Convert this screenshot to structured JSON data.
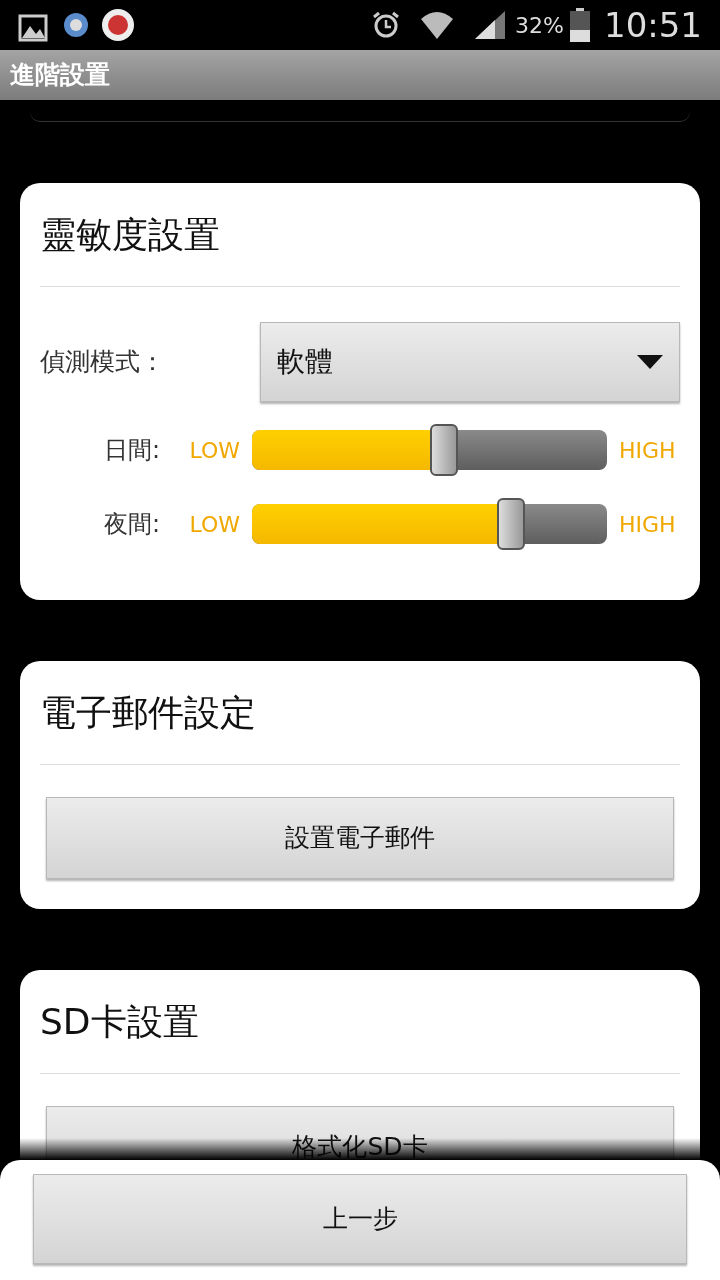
{
  "status_bar": {
    "battery": "32%",
    "time": "10:51"
  },
  "title_bar": {
    "title": "進階設置"
  },
  "sensitivity": {
    "title": "靈敏度設置",
    "mode_label": "偵測模式：",
    "mode_value": "軟體",
    "sliders": [
      {
        "label": "日間:",
        "low": "LOW",
        "high": "HIGH",
        "level": 0.54
      },
      {
        "label": "夜間:",
        "low": "LOW",
        "high": "HIGH",
        "level": 0.73
      }
    ]
  },
  "email": {
    "title": "電子郵件設定",
    "button": "設置電子郵件"
  },
  "sd_card": {
    "title": "SD卡設置",
    "button": "格式化SD卡"
  },
  "footer": {
    "button": "上一步"
  }
}
